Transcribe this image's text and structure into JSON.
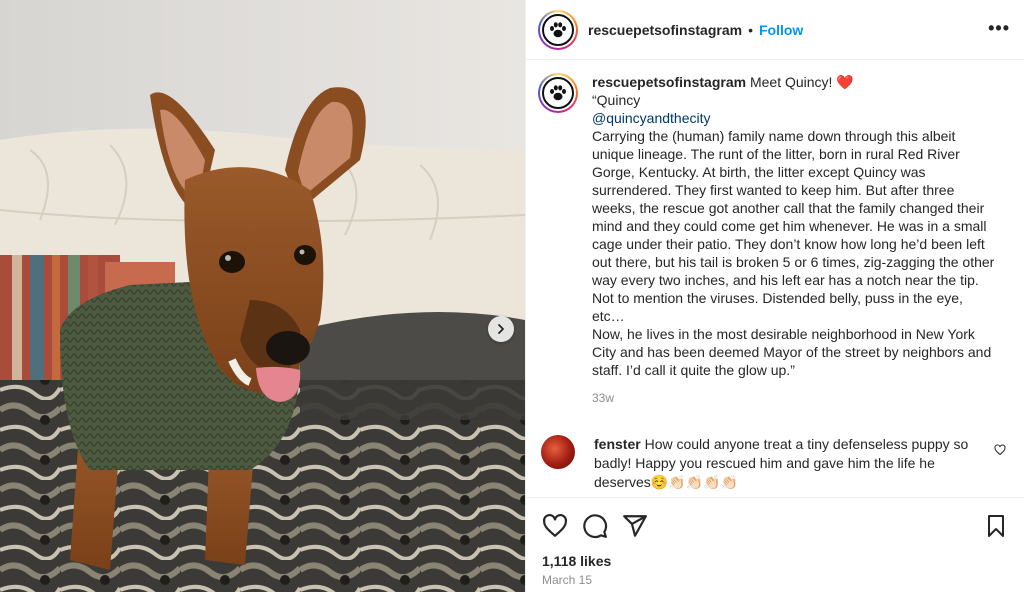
{
  "post": {
    "username": "rescuepetsofinstagram",
    "separator": "•",
    "follow_label": "Follow",
    "more_label": "•••"
  },
  "caption": {
    "username": "rescuepetsofinstagram",
    "intro": "Meet Quincy!",
    "heart_emoji": "❤️",
    "line_quincy": "“Quincy",
    "mention": "@quincyandthecity",
    "paragraph1": "Carrying the (human) family name down through this albeit unique lineage. The runt of the litter, born in rural Red River Gorge, Kentucky. At birth, the litter except Quincy was surrendered. They first wanted to keep him. But after three weeks, the rescue got another call that the family changed their mind and they could come get him whenever. He was in a small cage under their patio. They don’t know how long he’d been left out there, but his tail is broken 5 or 6 times, zig-zagging the other way every two inches, and his left ear has a notch near the tip. Not to mention the viruses. Distended belly, puss in the eye, etc…",
    "paragraph2": "Now, he lives in the most desirable neighborhood in New York City and has been deemed Mayor of the street by neighbors and staff. I’d call it quite the glow up.”",
    "time": "33w"
  },
  "comment": {
    "username": "fenster",
    "text": "How could anyone treat a tiny defenseless puppy so badly! Happy you rescued him and gave him the life he deserves☺️👏🏻👏🏻👏🏻👏🏻"
  },
  "footer": {
    "likes": "1,118 likes",
    "date": "March 15"
  },
  "icons": {
    "avatar": "paw-icon",
    "like": "heart-icon",
    "comment": "comment-icon",
    "share": "send-icon",
    "save": "bookmark-icon",
    "next": "chevron-right-icon",
    "comment_like": "heart-icon"
  },
  "colors": {
    "follow": "#0095f6",
    "mention": "#00376b",
    "heart": "#ed4956",
    "muted": "#8e8e8e"
  }
}
